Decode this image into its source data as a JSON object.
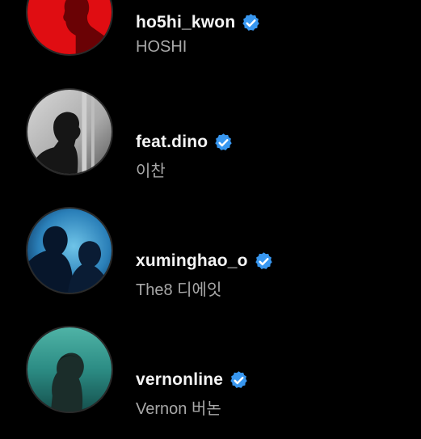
{
  "accounts": [
    {
      "username": "ho5hi_kwon",
      "full_name": "HOSHI",
      "verified": true,
      "avatar_icon": "profile-photo-red-silhouette"
    },
    {
      "username": "feat.dino",
      "full_name": "이찬",
      "verified": true,
      "avatar_icon": "profile-photo-monochrome"
    },
    {
      "username": "xuminghao_o",
      "full_name": "The8 디에잇",
      "verified": true,
      "avatar_icon": "profile-photo-blue-silhouettes"
    },
    {
      "username": "vernonline",
      "full_name": "Vernon 버논",
      "verified": true,
      "avatar_icon": "profile-photo-teal"
    }
  ],
  "colors": {
    "background": "#000000",
    "username_text": "#f5f5f5",
    "fullname_text": "#a8a8a8",
    "verified_badge": "#3897f0"
  }
}
